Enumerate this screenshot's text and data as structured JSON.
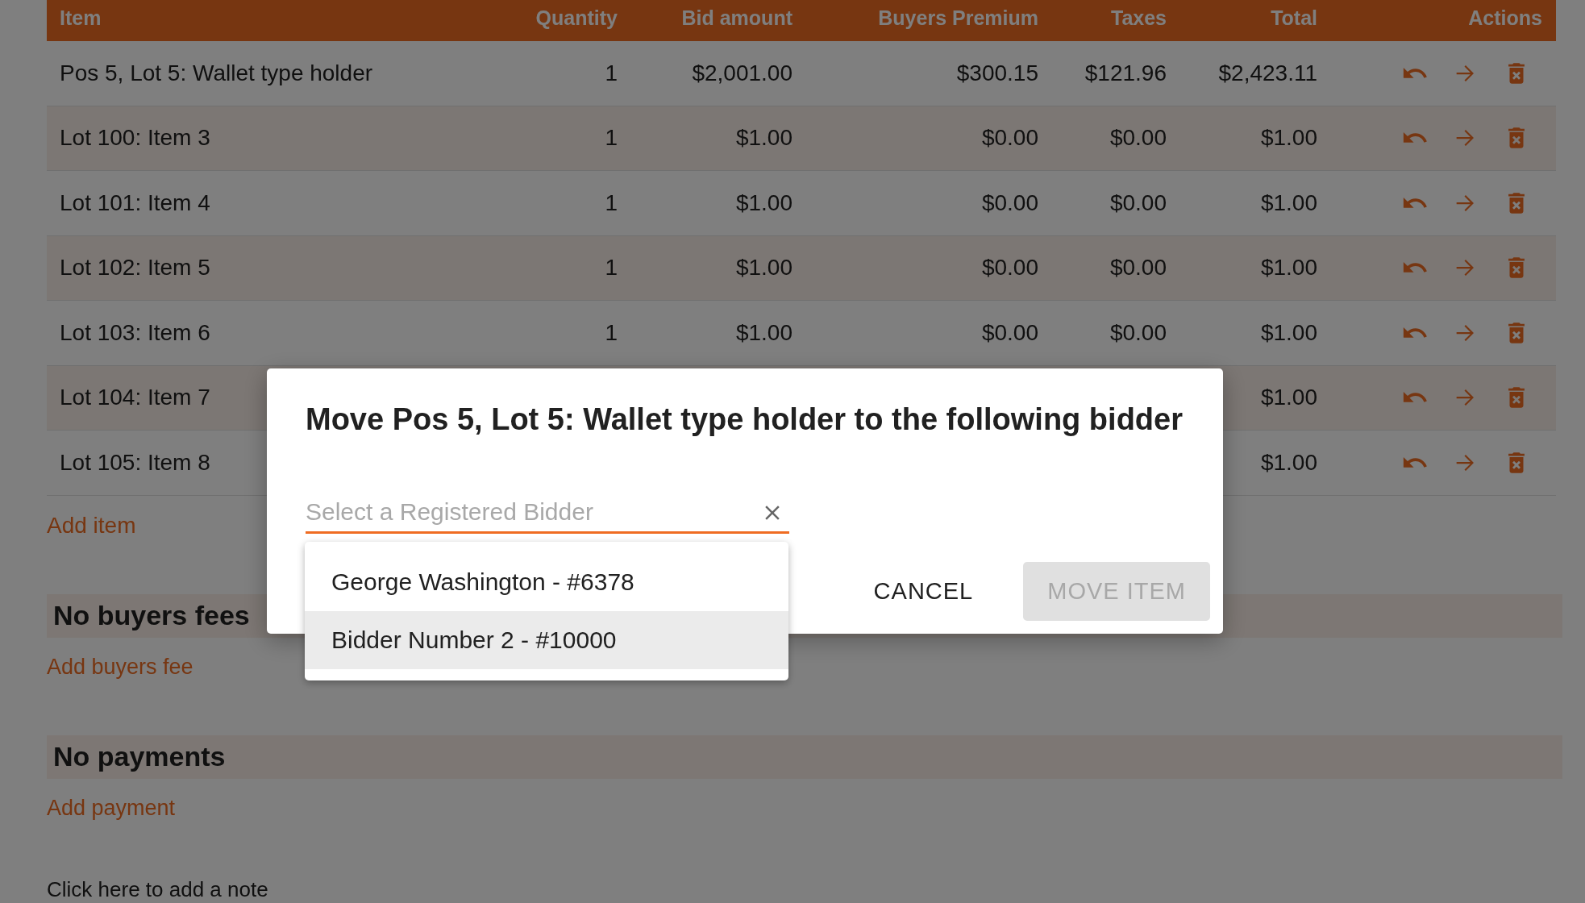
{
  "table": {
    "columns": [
      "Item",
      "Quantity",
      "Bid amount",
      "Buyers Premium",
      "Taxes",
      "Total",
      "Actions"
    ],
    "rows": [
      {
        "item": "Pos 5, Lot 5: Wallet type holder",
        "quantity": "1",
        "bid": "$2,001.00",
        "premium": "$300.15",
        "taxes": "$121.96",
        "total": "$2,423.11"
      },
      {
        "item": "Lot 100: Item 3",
        "quantity": "1",
        "bid": "$1.00",
        "premium": "$0.00",
        "taxes": "$0.00",
        "total": "$1.00"
      },
      {
        "item": "Lot 101: Item 4",
        "quantity": "1",
        "bid": "$1.00",
        "premium": "$0.00",
        "taxes": "$0.00",
        "total": "$1.00"
      },
      {
        "item": "Lot 102: Item 5",
        "quantity": "1",
        "bid": "$1.00",
        "premium": "$0.00",
        "taxes": "$0.00",
        "total": "$1.00"
      },
      {
        "item": "Lot 103: Item 6",
        "quantity": "1",
        "bid": "$1.00",
        "premium": "$0.00",
        "taxes": "$0.00",
        "total": "$1.00"
      },
      {
        "item": "Lot 104: Item 7",
        "total": "$1.00"
      },
      {
        "item": "Lot 105: Item 8",
        "total": "$1.00"
      }
    ],
    "add_link": "Add item"
  },
  "sections": [
    {
      "heading": "No buyers fees",
      "link": "Add buyers fee"
    },
    {
      "heading": "No payments",
      "link": "Add payment"
    }
  ],
  "note_link": "Click here to add a note",
  "dialog": {
    "title": "Move Pos 5, Lot 5: Wallet type holder to the following bidder",
    "field": {
      "placeholder": "Select a Registered Bidder"
    },
    "options": [
      {
        "label": "George Washington - #6378",
        "highlighted": false
      },
      {
        "label": "Bidder Number 2 - #10000",
        "highlighted": true
      }
    ],
    "buttons": [
      {
        "label": "CANCEL",
        "disabled": false
      },
      {
        "label": "MOVE ITEM",
        "disabled": true
      }
    ]
  }
}
